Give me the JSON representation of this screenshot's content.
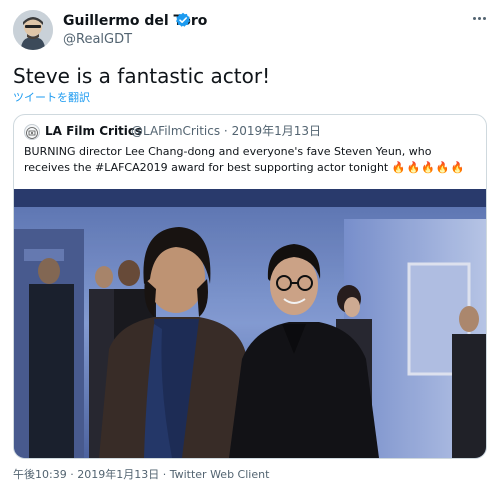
{
  "author": {
    "display_name": "Guillermo del Toro",
    "handle": "@RealGDT",
    "verified_icon": "verified-badge-icon"
  },
  "tweet": {
    "text": "Steve is a fantastic actor!",
    "translate_label": "ツイートを翻訳"
  },
  "quoted": {
    "name": "LA Film Critics",
    "handle": "@LAFilmCritics",
    "separator": "·",
    "date": "2019年1月13日",
    "text_line1": "BURNING director Lee Chang-dong and everyone's fave Steven Yeun, who",
    "text_line2": "receives the #LAFCA2019 award for best supporting actor tonight",
    "emoji": "🔥🔥🔥🔥🔥"
  },
  "footer": {
    "time": "午後10:39",
    "separator1": "·",
    "date": "2019年1月13日",
    "separator2": "·",
    "client": "Twitter Web Client"
  },
  "colors": {
    "link": "#1d9bf0",
    "muted": "#536471",
    "border": "#cfd9de",
    "fire": "#f2711c"
  }
}
